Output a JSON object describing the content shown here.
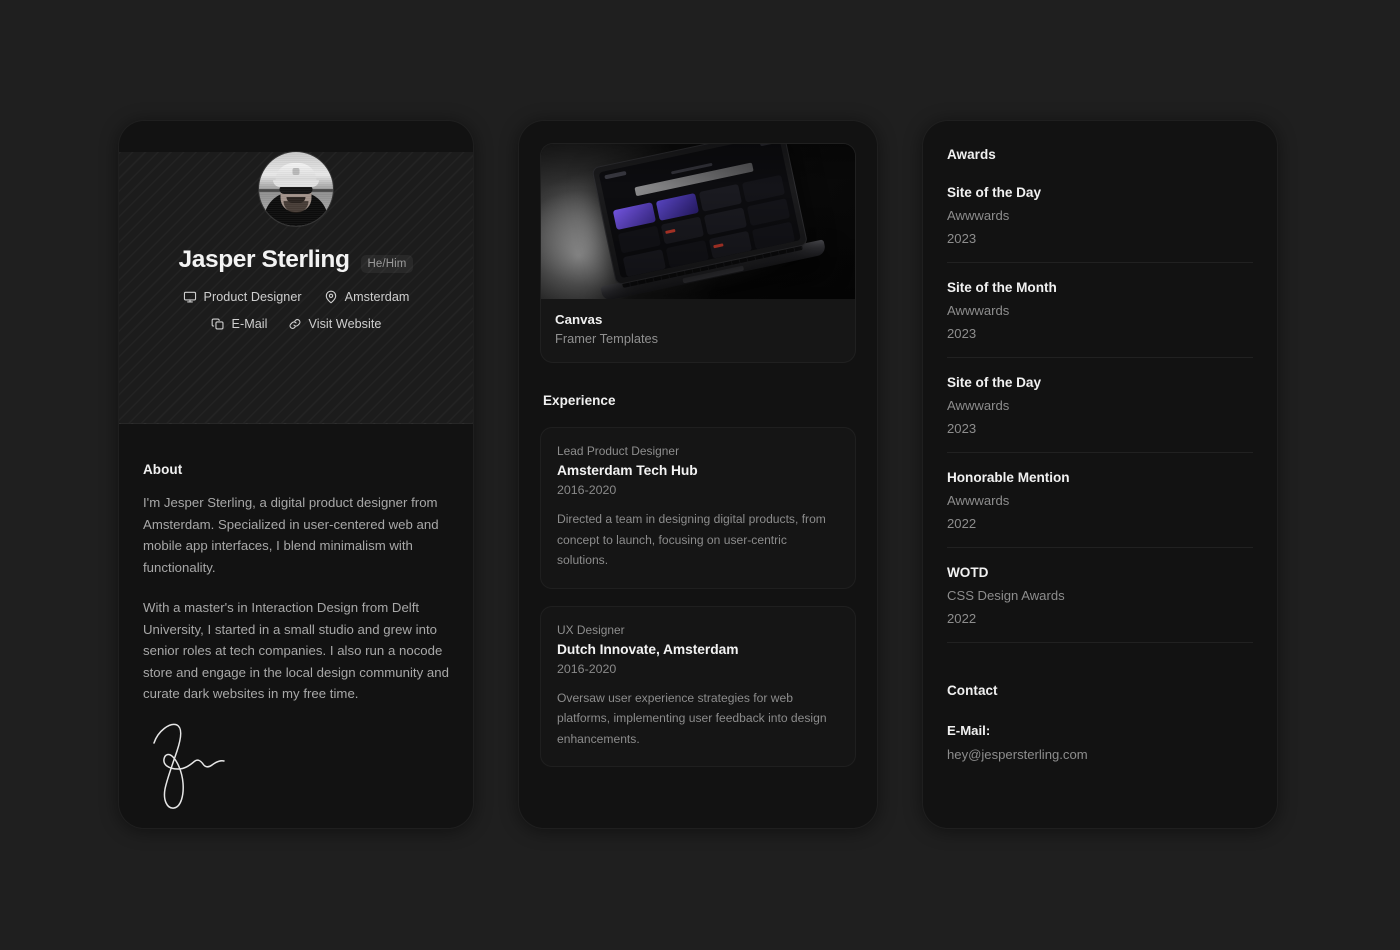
{
  "theme": {
    "page_background": "#1f1f1f",
    "card_background": "#121212",
    "text_primary": "#f1f1f1",
    "text_muted": "#8d8d8d",
    "accent_violet": "#7b5bf0"
  },
  "profile": {
    "avatar_alt": "Black and white portrait of a man wearing a cap and sunglasses",
    "name": "Jasper Sterling",
    "pronouns": "He/Him",
    "meta": [
      {
        "icon": "monitor-icon",
        "label": "Product Designer"
      },
      {
        "icon": "map-pin-icon",
        "label": "Amsterdam"
      }
    ],
    "actions": [
      {
        "icon": "copy-icon",
        "label": "E-Mail"
      },
      {
        "icon": "link-icon",
        "label": "Visit Website"
      }
    ],
    "about": {
      "heading": "About",
      "paragraphs": [
        "I'm Jesper Sterling, a digital product designer from Amsterdam. Specialized in user-centered web and mobile app interfaces, I blend minimalism with functionality.",
        "With a master's in Interaction Design from Delft University, I started in a small studio and grew into senior roles at tech companies. I also run a nocode store and engage in the local design community and curate dark websites in my free time."
      ]
    },
    "signature_alt": "Handwritten signature"
  },
  "work": {
    "project": {
      "thumb_alt": "Dark laptop mockup showing a website template gallery",
      "screen_headline": "Go Beyond Ordinary Websites",
      "title": "Canvas",
      "subtitle": "Framer Templates"
    },
    "experience_heading": "Experience",
    "experience": [
      {
        "role": "Lead Product Designer",
        "org": "Amsterdam Tech Hub",
        "dates": "2016-2020",
        "description": "Directed a team in designing digital products, from concept to launch, focusing on user-centric solutions."
      },
      {
        "role": "UX Designer",
        "org": "Dutch Innovate, Amsterdam",
        "dates": "2016-2020",
        "description": "Oversaw user experience strategies for web platforms, implementing user feedback into design enhancements."
      }
    ]
  },
  "awards": {
    "heading": "Awards",
    "items": [
      {
        "title": "Site of the Day",
        "org": "Awwwards",
        "year": "2023"
      },
      {
        "title": "Site of the Month",
        "org": "Awwwards",
        "year": "2023"
      },
      {
        "title": "Site of the Day",
        "org": "Awwwards",
        "year": "2023"
      },
      {
        "title": "Honorable Mention",
        "org": "Awwwards",
        "year": "2022"
      },
      {
        "title": "WOTD",
        "org": "CSS Design Awards",
        "year": "2022"
      }
    ]
  },
  "contact": {
    "heading": "Contact",
    "email_label": "E-Mail:",
    "email_value": "hey@jespersterling.com"
  }
}
